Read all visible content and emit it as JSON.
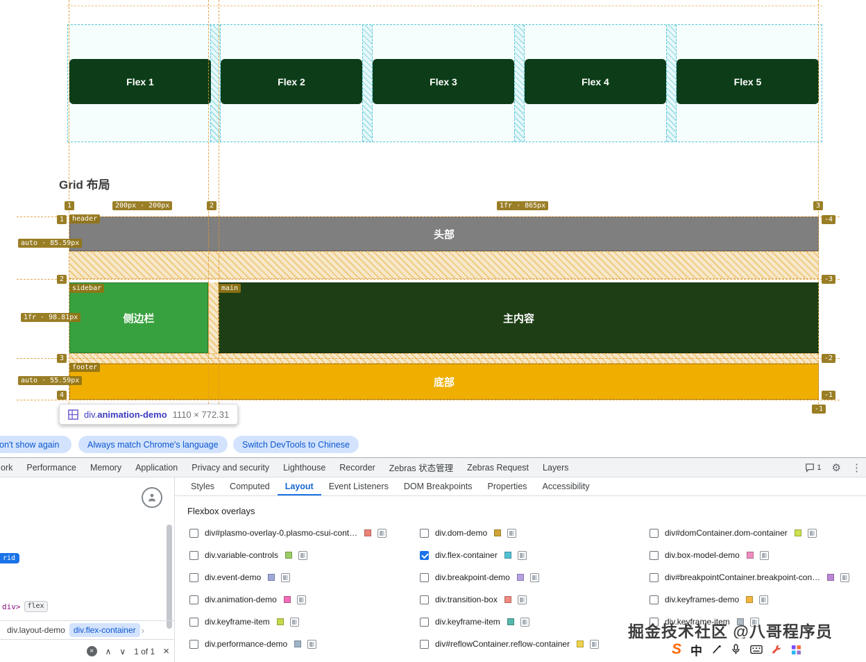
{
  "page": {
    "flex_items": [
      "Flex 1",
      "Flex 2",
      "Flex 3",
      "Flex 4",
      "Flex 5"
    ],
    "flex_item_color": "#0c3d18",
    "grid_heading": "Grid 布局",
    "areas": {
      "header": {
        "name": "header",
        "text": "头部",
        "color": "#7f7f7f"
      },
      "sidebar": {
        "name": "sidebar",
        "text": "侧边栏",
        "color": "#38a13f"
      },
      "main": {
        "name": "main",
        "text": "主内容",
        "color": "#1e3f15"
      },
      "footer": {
        "name": "footer",
        "text": "底部",
        "color": "#efae00"
      }
    },
    "grid": {
      "col_track_labels": [
        "200px · 200px",
        "1fr · 865px"
      ],
      "row_track_labels": [
        "auto · 85.59px",
        "1fr · 98.81px",
        "auto · 55.59px"
      ],
      "col_line_numbers": [
        "1",
        "2",
        "3"
      ],
      "row_line_numbers": [
        "1",
        "2",
        "3",
        "4"
      ],
      "neg_row_line_numbers": [
        "-4",
        "-3",
        "-2",
        "-1"
      ],
      "neg_col_line_number": "-1"
    },
    "tooltip": {
      "tag": "div.",
      "class": "animation-demo",
      "size": "1110 × 772.31"
    }
  },
  "infobar": {
    "dismiss_label": "on't show again",
    "match_label": "Always match Chrome's language",
    "switch_label": "Switch DevTools to Chinese"
  },
  "devtools": {
    "accent": "#1a73e8",
    "main_tabs": [
      "ork",
      "Performance",
      "Memory",
      "Application",
      "Privacy and security",
      "Lighthouse",
      "Recorder",
      "Zebras 状态管理",
      "Zebras Request",
      "Layers"
    ],
    "feedback_count": "1",
    "side_tabs": [
      "Styles",
      "Computed",
      "Layout",
      "Event Listeners",
      "DOM Breakpoints",
      "Properties",
      "Accessibility"
    ],
    "active_side_tab": "Layout",
    "layout_panel": {
      "title": "Flexbox overlays",
      "col1": [
        {
          "label": "div#plasmo-overlay-0.plasmo-csui-cont…",
          "checked": false,
          "swatch": "#ee8277"
        },
        {
          "label": "div.variable-controls",
          "checked": false,
          "swatch": "#9ccc65"
        },
        {
          "label": "div.event-demo",
          "checked": false,
          "swatch": "#9fa8da"
        },
        {
          "label": "div.animation-demo",
          "checked": false,
          "swatch": "#f06eb5"
        },
        {
          "label": "div.keyframe-item",
          "checked": false,
          "swatch": "#c5d94a"
        },
        {
          "label": "div.performance-demo",
          "checked": false,
          "swatch": "#9fb4c7"
        }
      ],
      "col2": [
        {
          "label": "div.dom-demo",
          "checked": false,
          "swatch": "#cfa635"
        },
        {
          "label": "div.flex-container",
          "checked": true,
          "swatch": "#52c1d4"
        },
        {
          "label": "div.breakpoint-demo",
          "checked": false,
          "swatch": "#b5a0e3"
        },
        {
          "label": "div.transition-box",
          "checked": false,
          "swatch": "#ef8a80"
        },
        {
          "label": "div.keyframe-item",
          "checked": false,
          "swatch": "#55b8ab"
        },
        {
          "label": "div#reflowContainer.reflow-container",
          "checked": false,
          "swatch": "#edd24a"
        }
      ],
      "col3": [
        {
          "label": "div#domContainer.dom-container",
          "checked": false,
          "swatch": "#cde04e"
        },
        {
          "label": "div.box-model-demo",
          "checked": false,
          "swatch": "#f08cc0"
        },
        {
          "label": "div#breakpointContainer.breakpoint-con…",
          "checked": false,
          "swatch": "#bb86d6"
        },
        {
          "label": "div.keyframes-demo",
          "checked": false,
          "swatch": "#f2b63e"
        },
        {
          "label": "div.keyframe-item",
          "checked": false,
          "swatch": "#aeb9c2"
        }
      ]
    },
    "elements_pane": {
      "grid_badge": "rid",
      "dom_fragment": "div>",
      "flex_badge": "flex",
      "breadcrumb": [
        "div.layout-demo",
        "div.flex-container"
      ],
      "find_count": "1 of 1"
    }
  },
  "watermark": "掘金技术社区 @八哥程序员",
  "ime": {
    "logo": "S",
    "mode": "中"
  }
}
